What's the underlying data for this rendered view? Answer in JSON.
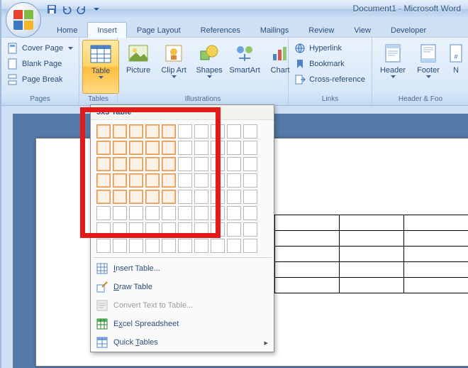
{
  "title": "Document1 - Microsoft Word",
  "tabs": [
    "Home",
    "Insert",
    "Page Layout",
    "References",
    "Mailings",
    "Review",
    "View",
    "Developer"
  ],
  "active_tab": 1,
  "groups": {
    "pages": {
      "title": "Pages",
      "cover": "Cover Page",
      "blank": "Blank Page",
      "break": "Page Break"
    },
    "tables": {
      "title": "Tables",
      "table": "Table"
    },
    "illustrations": {
      "title": "Illustrations",
      "picture": "Picture",
      "clipart": "Clip Art",
      "shapes": "Shapes",
      "smartart": "SmartArt",
      "chart": "Chart"
    },
    "links": {
      "title": "Links",
      "hyperlink": "Hyperlink",
      "bookmark": "Bookmark",
      "crossref": "Cross-reference"
    },
    "headerfooter": {
      "title": "Header & Foo",
      "header": "Header",
      "footer": "Footer",
      "number": "N"
    }
  },
  "dropdown": {
    "header": "5x5 Table",
    "sel_rows": 5,
    "sel_cols": 5,
    "insert": "Insert Table...",
    "draw": "Draw Table",
    "convert": "Convert Text to Table...",
    "excel": "Excel Spreadsheet",
    "quick": "Quick Tables"
  },
  "preview_table": {
    "rows": 5,
    "cols": 3
  },
  "colors": {
    "accent": "#ffbd3e",
    "highlight": "#e21a1a",
    "sel": "#e8954e"
  }
}
